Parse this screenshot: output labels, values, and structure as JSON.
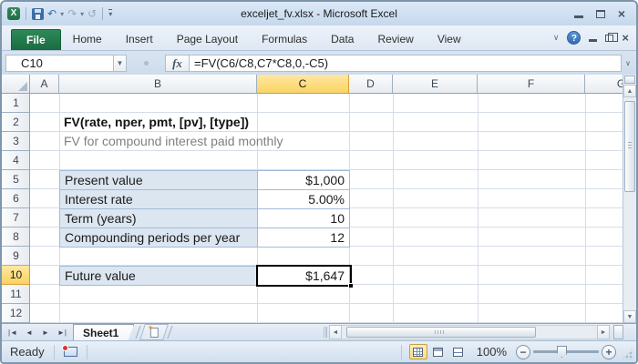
{
  "window": {
    "title": "exceljet_fv.xlsx - Microsoft Excel"
  },
  "quick_access": {
    "excel_logo_glyph": "X",
    "undo_glyph": "↶",
    "redo_glyph": "↷",
    "repeat_glyph": "↺",
    "dropdown_glyph": "▾"
  },
  "ribbon": {
    "file_tab": "File",
    "tabs": [
      "Home",
      "Insert",
      "Page Layout",
      "Formulas",
      "Data",
      "Review",
      "View"
    ],
    "collapse_glyph": "∨",
    "help_glyph": "?"
  },
  "formula_bar": {
    "name_box": "C10",
    "name_box_dropdown_glyph": "▼",
    "fx_label": "fx",
    "formula": "=FV(C6/C8,C7*C8,0,-C5)",
    "expand_glyph": "∨"
  },
  "grid": {
    "columns": [
      "A",
      "B",
      "C",
      "D",
      "E",
      "F",
      "G"
    ],
    "rows": [
      "1",
      "2",
      "3",
      "4",
      "5",
      "6",
      "7",
      "8",
      "9",
      "10",
      "11",
      "12"
    ],
    "selection": {
      "cell": "C10",
      "column": "C",
      "row": "10"
    }
  },
  "sheet": {
    "cells": [
      {
        "row": 2,
        "col": "B",
        "style": "title",
        "text": "FV(rate, nper, pmt, [pv], [type])"
      },
      {
        "row": 3,
        "col": "B",
        "style": "subtitle",
        "text": "FV for compound interest paid monthly"
      },
      {
        "row": 5,
        "col": "B",
        "style": "label",
        "text": "Present value"
      },
      {
        "row": 5,
        "col": "C",
        "style": "value",
        "text": "$1,000"
      },
      {
        "row": 6,
        "col": "B",
        "style": "label",
        "text": "Interest rate"
      },
      {
        "row": 6,
        "col": "C",
        "style": "value",
        "text": "5.00%"
      },
      {
        "row": 7,
        "col": "B",
        "style": "label",
        "text": "Term (years)"
      },
      {
        "row": 7,
        "col": "C",
        "style": "value",
        "text": "10"
      },
      {
        "row": 8,
        "col": "B",
        "style": "label",
        "text": "Compounding periods per year"
      },
      {
        "row": 8,
        "col": "C",
        "style": "value",
        "text": "12"
      },
      {
        "row": 10,
        "col": "B",
        "style": "label",
        "text": "Future value"
      },
      {
        "row": 10,
        "col": "C",
        "style": "value",
        "text": "$1,647"
      }
    ]
  },
  "sheet_tabs": {
    "active": "Sheet1"
  },
  "status_bar": {
    "mode": "Ready",
    "zoom_level": "100%"
  },
  "colors": {
    "file_tab_green": "#1E7145",
    "selected_header_amber": "#FBD25F",
    "table_fill_blue": "#DCE6F1",
    "table_border_blue": "#A3BAD9",
    "gridline": "#D6DDE8",
    "help_blue": "#3B76BF",
    "subtitle_gray": "#808080"
  }
}
